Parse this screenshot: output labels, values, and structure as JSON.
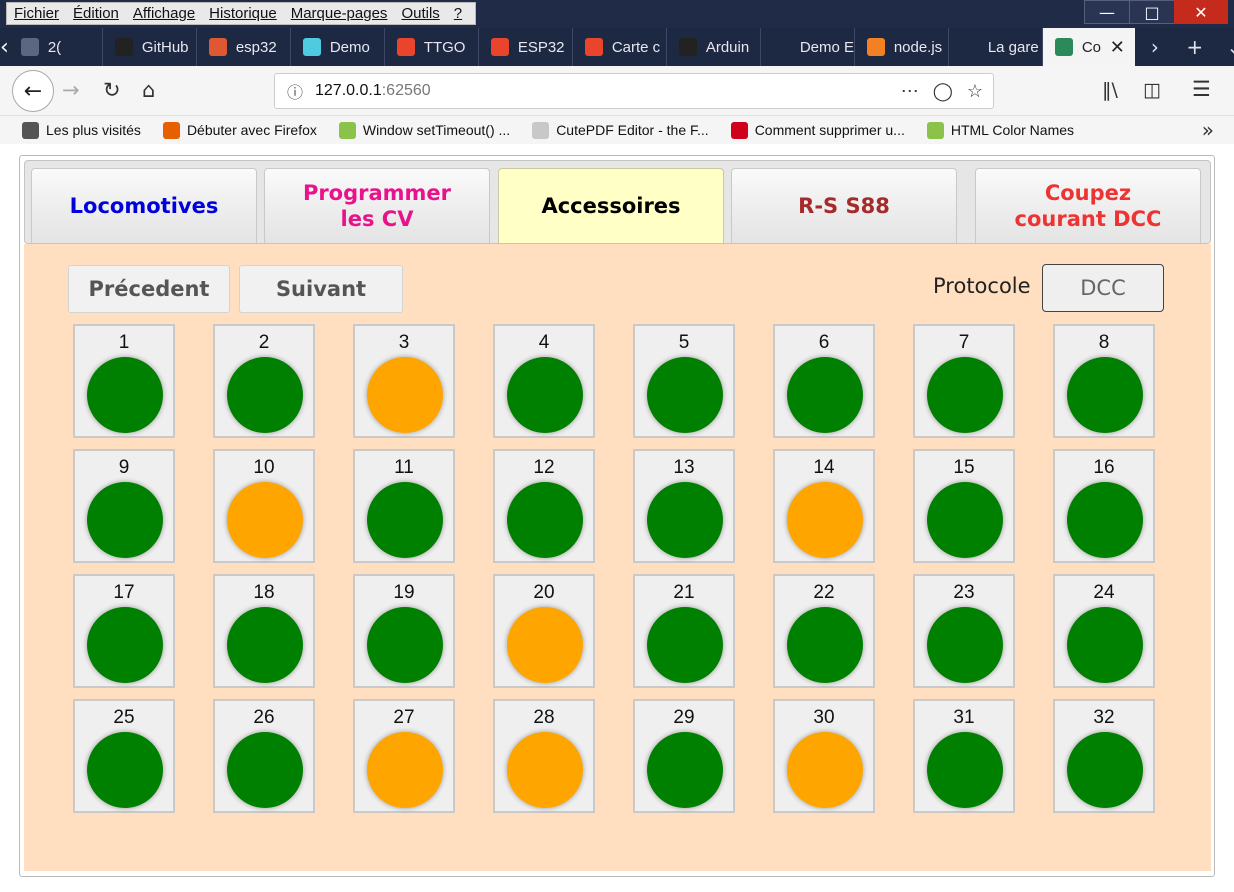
{
  "menubar": {
    "items": [
      "Fichier",
      "Édition",
      "Affichage",
      "Historique",
      "Marque-pages",
      "Outils",
      "?"
    ]
  },
  "tabs": [
    {
      "title": "2(",
      "icon": "page-icon",
      "color": "#5a6682"
    },
    {
      "title": "GitHub",
      "icon": "github-icon",
      "color": "#222222"
    },
    {
      "title": "esp32",
      "icon": "duckduckgo-icon",
      "color": "#de5833"
    },
    {
      "title": "Demo",
      "icon": "page-icon",
      "color": "#4ecbe0"
    },
    {
      "title": "TTGO",
      "icon": "aliexpress-icon",
      "color": "#e8452c"
    },
    {
      "title": "ESP32",
      "icon": "aliexpress-icon",
      "color": "#e8452c"
    },
    {
      "title": "Carte c",
      "icon": "aliexpress-icon",
      "color": "#e8452c"
    },
    {
      "title": "Arduin",
      "icon": "github-icon",
      "color": "#222222"
    },
    {
      "title": "Demo ESP",
      "icon": "page-icon",
      "color": "#1d2842"
    },
    {
      "title": "node.js",
      "icon": "stackoverflow-icon",
      "color": "#f48024"
    },
    {
      "title": "La gare de",
      "icon": "page-icon",
      "color": "#1d2842"
    },
    {
      "title": "Co",
      "icon": "locomotive-icon",
      "color": "#2a8a5a",
      "active": true
    }
  ],
  "url": {
    "host": "127.0.0.1",
    "port": ":62560"
  },
  "bookmarks": [
    {
      "label": "Les plus visités",
      "icon": "gear-icon",
      "color": "#555555"
    },
    {
      "label": "Débuter avec Firefox",
      "icon": "firefox-icon",
      "color": "#e66000"
    },
    {
      "label": "Window setTimeout() ...",
      "icon": "w3schools-icon",
      "color": "#8bc34a"
    },
    {
      "label": "CutePDF Editor - the F...",
      "icon": "pdf-icon",
      "color": "#c8c8c8"
    },
    {
      "label": "Comment supprimer u...",
      "icon": "ta-icon",
      "color": "#d0021b"
    },
    {
      "label": "HTML Color Names",
      "icon": "w3schools-icon",
      "color": "#8bc34a"
    }
  ],
  "app": {
    "nav": [
      {
        "label": "Locomotives",
        "color": "#0000dd",
        "active": false
      },
      {
        "label": "Programmer\nles CV",
        "color": "#e8138a",
        "active": false
      },
      {
        "label": "Accessoires",
        "color": "#000000",
        "active": true
      },
      {
        "label": "R-S  S88",
        "color": "#a52a2a",
        "active": false
      },
      {
        "label": "Coupez\ncourant DCC",
        "color": "#ee3333",
        "active": false
      }
    ],
    "prev_label": "Précedent",
    "next_label": "Suivant",
    "protocol_label": "Protocole",
    "protocol_value": "DCC",
    "colors": {
      "green": "#008000",
      "orange": "#ffa500"
    },
    "accessories": [
      {
        "n": "1",
        "state": "green"
      },
      {
        "n": "2",
        "state": "green"
      },
      {
        "n": "3",
        "state": "orange"
      },
      {
        "n": "4",
        "state": "green"
      },
      {
        "n": "5",
        "state": "green"
      },
      {
        "n": "6",
        "state": "green"
      },
      {
        "n": "7",
        "state": "green"
      },
      {
        "n": "8",
        "state": "green"
      },
      {
        "n": "9",
        "state": "green"
      },
      {
        "n": "10",
        "state": "orange"
      },
      {
        "n": "11",
        "state": "green"
      },
      {
        "n": "12",
        "state": "green"
      },
      {
        "n": "13",
        "state": "green"
      },
      {
        "n": "14",
        "state": "orange"
      },
      {
        "n": "15",
        "state": "green"
      },
      {
        "n": "16",
        "state": "green"
      },
      {
        "n": "17",
        "state": "green"
      },
      {
        "n": "18",
        "state": "green"
      },
      {
        "n": "19",
        "state": "green"
      },
      {
        "n": "20",
        "state": "orange"
      },
      {
        "n": "21",
        "state": "green"
      },
      {
        "n": "22",
        "state": "green"
      },
      {
        "n": "23",
        "state": "green"
      },
      {
        "n": "24",
        "state": "green"
      },
      {
        "n": "25",
        "state": "green"
      },
      {
        "n": "26",
        "state": "green"
      },
      {
        "n": "27",
        "state": "orange"
      },
      {
        "n": "28",
        "state": "orange"
      },
      {
        "n": "29",
        "state": "green"
      },
      {
        "n": "30",
        "state": "orange"
      },
      {
        "n": "31",
        "state": "green"
      },
      {
        "n": "32",
        "state": "green"
      }
    ]
  }
}
